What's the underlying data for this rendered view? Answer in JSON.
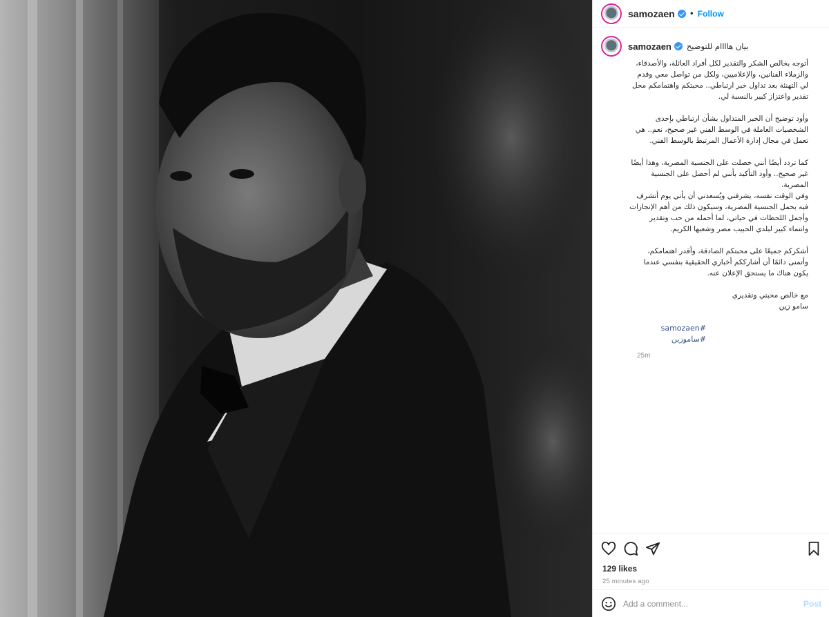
{
  "colors": {
    "accent": "#0095f6",
    "hashtag": "#385185",
    "muted": "#8e8e8e",
    "verified": "#3897f0",
    "post_disabled": "#b3dbff"
  },
  "header": {
    "username": "samozaen",
    "separator": "•",
    "follow_label": "Follow"
  },
  "caption": {
    "username": "samozaen",
    "title": "بيان هاااام للتوضيح",
    "paragraphs": [
      "أتوجه بخالص الشكر والتقدير لكل أفراد العائلة، والأصدقاء، والزملاء الفنانين، والإعلاميين، ولكل من تواصل معي وقدم لي التهنئة بعد تداول خبر ارتباطي.. محبتكم واهتمامكم محل تقدير واعتزاز كبير بالنسبة لي.",
      "وأود توضيح أن الخبر المتداول بشأن ارتباطي بإحدى الشخصيات العاملة في الوسط الفني غير صحيح، نعم.. هي تعمل في مجال إدارة الأعمال المرتبط بالوسط الفني.",
      "كما تردد أيضًا أنني حصلت على الجنسية المصرية، وهذا أيضًا غير صحيح.. وأود التأكيد بأنني لم أحصل على الجنسية المصرية.\nوفي الوقت نفسه، يشرفني ويُسعدني أن يأتي يوم أتشرف فيه بحمل الجنسية المصرية، وسيكون ذلك من أهم الإنجازات وأجمل اللحظات في حياتي، لما أحمله من حب وتقدير وانتماء كبير لبلدي الحبيب مصر وشعبها الكريم.",
      "أشكركم جميعًا على محبتكم الصادقة، وأقدر اهتمامكم، وأتمنى دائمًا أن أشارككم أخباري الحقيقية بنفسي عندما يكون هناك ما يستحق الإعلان عنه.",
      "مع خالص محبتي وتقديري\nسامو زين"
    ],
    "hashtags": [
      "#samozaen",
      "#ساموزين"
    ],
    "time": "25m"
  },
  "actions": {
    "icons": [
      "heart-icon",
      "comment-icon",
      "share-icon",
      "bookmark-icon"
    ],
    "likes": "129 likes",
    "posted_ago": "25 minutes ago"
  },
  "comment": {
    "placeholder": "Add a comment...",
    "post_label": "Post"
  }
}
